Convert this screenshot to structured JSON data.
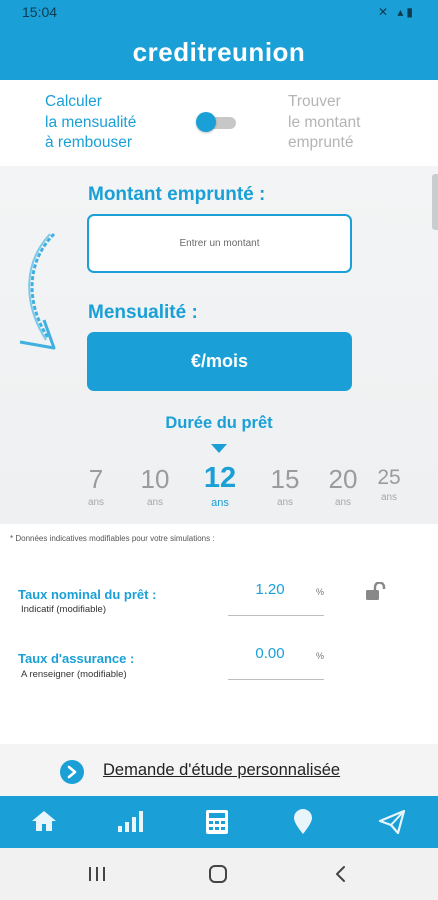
{
  "status_bar": {
    "time": "15:04",
    "icons_text": "✕ ▴▮"
  },
  "header": {
    "brand": "creditreunion"
  },
  "mode_toggle": {
    "left_lines": [
      "Calculer",
      "la mensualité",
      "à rembouser"
    ],
    "right_lines": [
      "Trouver",
      "le montant",
      "emprunté"
    ],
    "state": "left"
  },
  "form": {
    "amount_label": "Montant emprunté :",
    "amount_placeholder": "Entrer un montant",
    "monthly_label": "Mensualité :",
    "monthly_button": "€/mois"
  },
  "duration": {
    "title": "Durée du prêt",
    "unit": "ans",
    "options": [
      "7",
      "10",
      "12",
      "15",
      "20",
      "25"
    ],
    "selected": "12"
  },
  "rates": {
    "note": "* Données indicatives modifiables pour votre simulations :",
    "nominal_label": "Taux nominal du prêt :",
    "nominal_sub": "Indicatif (modifiable)",
    "nominal_value": "1.20",
    "insurance_label": "Taux d'assurance :",
    "insurance_sub": "A renseigner (modifiable)",
    "insurance_value": "0.00",
    "pct_symbol": "%"
  },
  "cta": {
    "label": "Demande d'étude personnalisée"
  },
  "bottom_nav": [
    "home-icon",
    "signal-bars-icon",
    "calculator-icon",
    "map-pin-icon",
    "send-icon"
  ],
  "colors": {
    "accent": "#1aa0d7",
    "text_dark": "#222222",
    "muted": "#9b9b9b"
  }
}
